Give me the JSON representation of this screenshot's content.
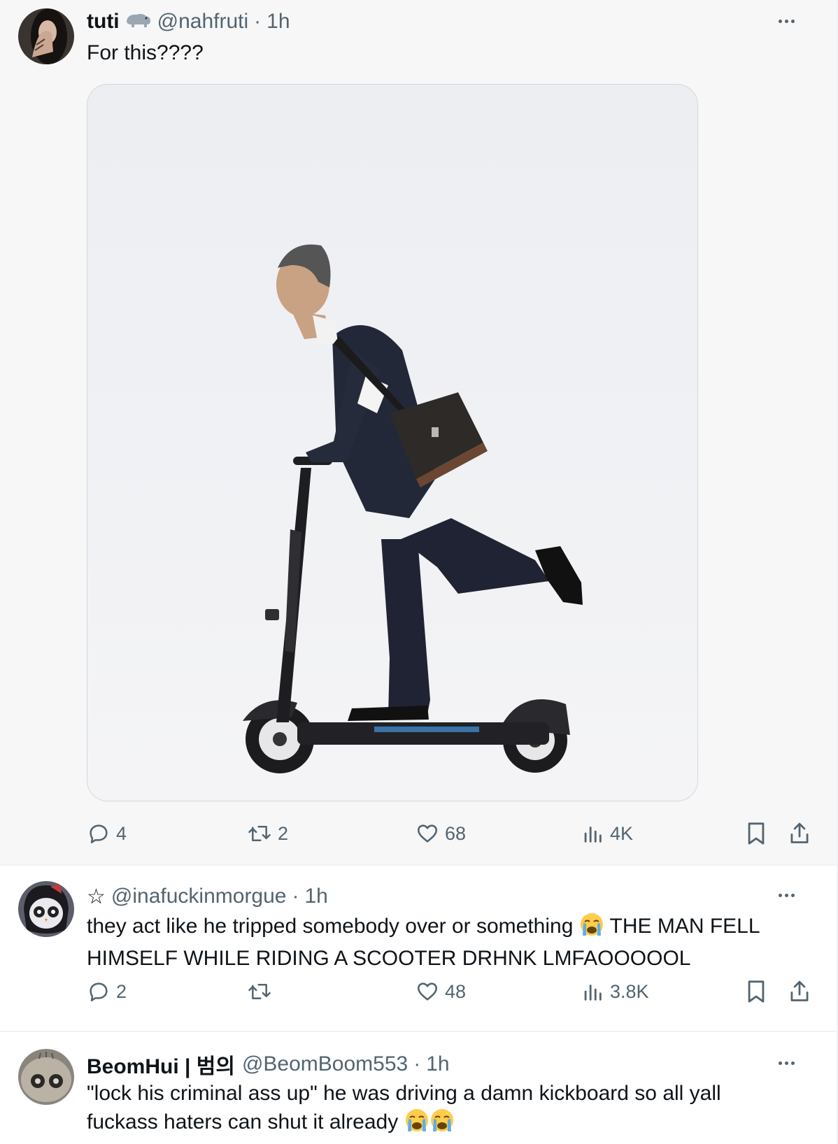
{
  "tweets": [
    {
      "name": "tuti",
      "handle": "@nahfruti",
      "time": "1h",
      "text": "For this????",
      "has_media": true,
      "stats": {
        "replies": "4",
        "reposts": "2",
        "likes": "68",
        "views": "4K"
      }
    },
    {
      "name": "",
      "handle": "@inafuckinmorgue",
      "time": "1h",
      "text_before_emoji": "they act like he tripped somebody over or something ",
      "text_after_emoji": " THE MAN FELL HIMSELF WHILE RIDING A SCOOTER DRHNK LMFAOOOOOL",
      "stats": {
        "replies": "2",
        "reposts": "",
        "likes": "48",
        "views": "3.8K"
      }
    },
    {
      "name": "BeomHui | 범의",
      "handle": "@BeomBoom553",
      "time": "1h",
      "text_before_emoji": "\"lock his criminal ass up\" he was driving a damn kickboard so all yall fuckass haters can shut it already "
    }
  ],
  "separator": "·",
  "colors": {
    "text": "#0f1419",
    "secondary": "#536471",
    "border": "#cfd9de",
    "highlight_bg": "#f7f7f7"
  },
  "icons": [
    "reply-icon",
    "repost-icon",
    "like-icon",
    "views-icon",
    "bookmark-icon",
    "share-icon",
    "more-icon",
    "hippo-badge-icon",
    "star-icon",
    "crying-emoji"
  ]
}
